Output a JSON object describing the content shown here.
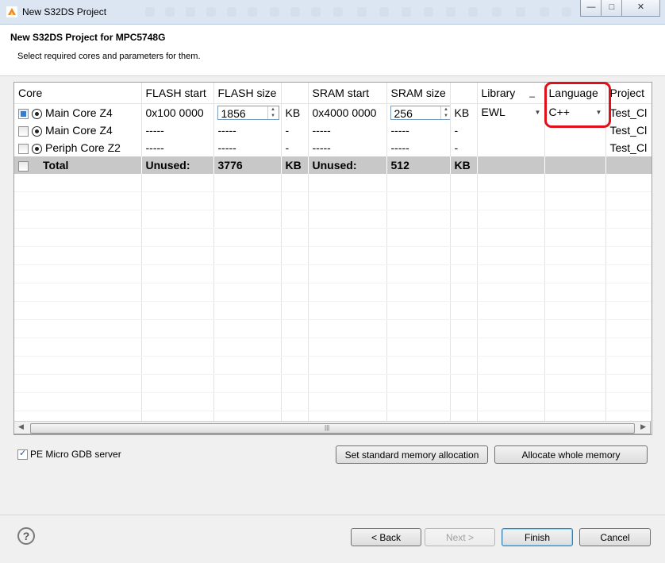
{
  "window": {
    "title": "New S32DS Project",
    "controls": [
      "—",
      "□",
      "✕"
    ]
  },
  "header": {
    "title": "New S32DS Project for MPC5748G",
    "subtitle": "Select required cores and parameters for them."
  },
  "table": {
    "columns": [
      "Core",
      "FLASH start",
      "FLASH size",
      "",
      "SRAM start",
      "SRAM size",
      "",
      "Library",
      "Language",
      "Project"
    ],
    "library_extra": "_",
    "rows": [
      {
        "core": "Main Core Z4",
        "flash_start": "0x100 0000",
        "flash_size": "1856",
        "flash_unit": "KB",
        "sram_start": "0x4000 0000",
        "sram_size": "256",
        "sram_unit": "KB",
        "library": "EWL",
        "language": "C++",
        "project": "Test_Cl"
      },
      {
        "core": "Main Core Z4",
        "flash_start": "-----",
        "flash_size": "-----",
        "flash_unit": "-",
        "sram_start": "-----",
        "sram_size": "-----",
        "sram_unit": "-",
        "library": "",
        "language": "",
        "project": "Test_Cl"
      },
      {
        "core": "Periph Core Z2",
        "flash_start": "-----",
        "flash_size": "-----",
        "flash_unit": "-",
        "sram_start": "-----",
        "sram_size": "-----",
        "sram_unit": "-",
        "library": "",
        "language": "",
        "project": "Test_Cl"
      }
    ],
    "total": {
      "label": "Total",
      "flash_unused_label": "Unused:",
      "flash_unused": "3776",
      "flash_unit": "KB",
      "sram_unused_label": "Unused:",
      "sram_unused": "512",
      "sram_unit": "KB"
    }
  },
  "options": {
    "gdb_label": "PE Micro GDB server",
    "gdb_checked": true
  },
  "buttons": {
    "standard_alloc": "Set standard memory allocation",
    "whole_memory": "Allocate whole memory",
    "back": "< Back",
    "next": "Next >",
    "finish": "Finish",
    "cancel": "Cancel"
  },
  "colors": {
    "highlight": "#e0101a",
    "total_row": "#c8c8c8",
    "titlebar": "#dce6f3"
  }
}
